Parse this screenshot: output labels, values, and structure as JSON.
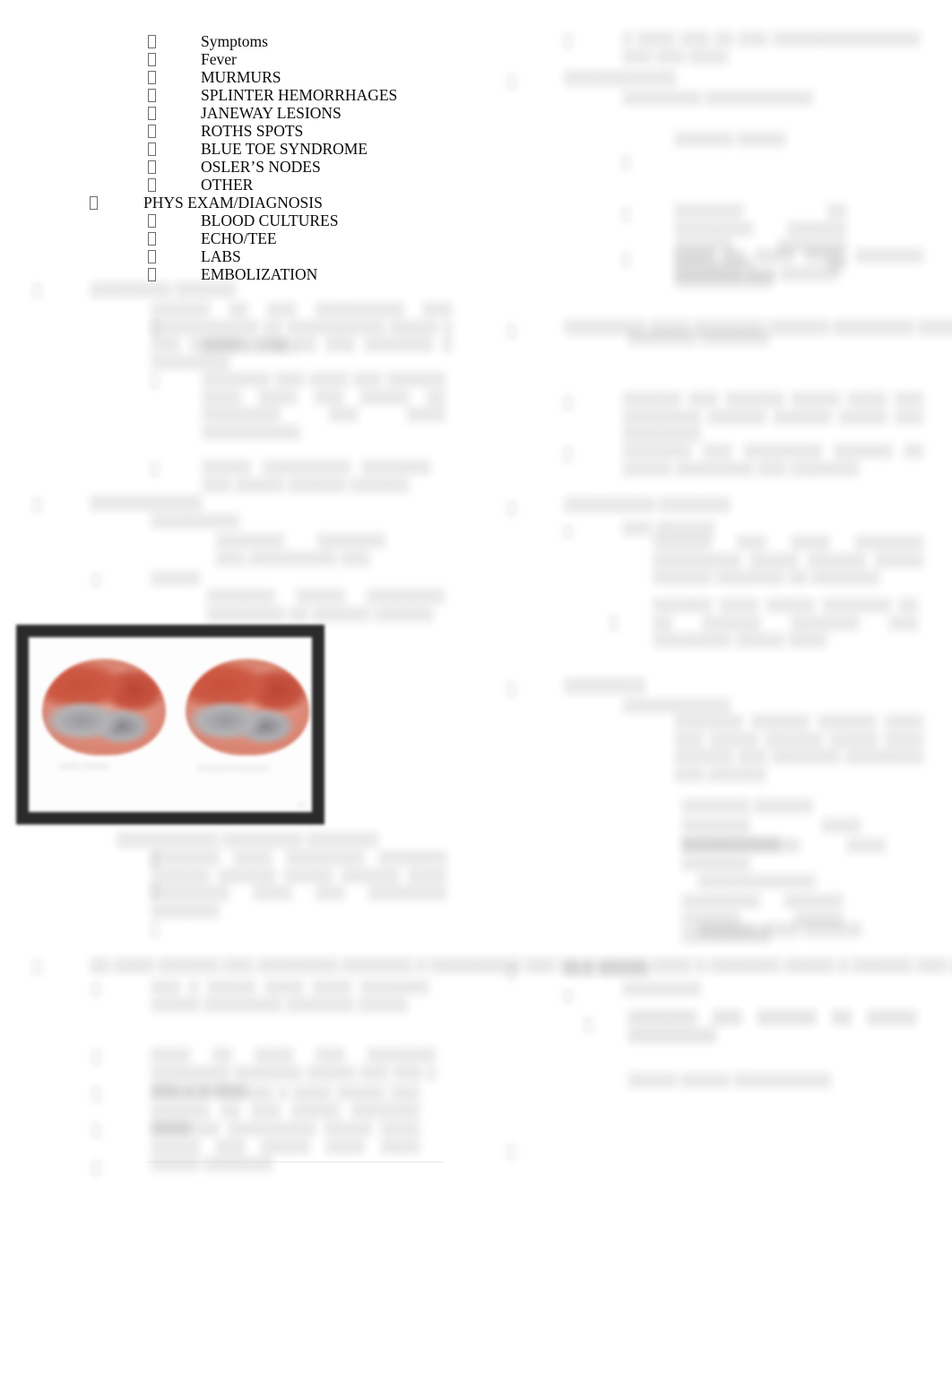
{
  "document": {
    "type": "outline-notes",
    "page_background": "#ffffff",
    "text_color": "#0b0b0b",
    "columns": 2
  },
  "left_column": {
    "legible_outline": {
      "items": [
        {
          "level": 2,
          "label": "Symptoms"
        },
        {
          "level": 2,
          "label": "Fever"
        },
        {
          "level": 2,
          "label": "MURMURS"
        },
        {
          "level": 2,
          "label": "SPLINTER HEMORRHAGES"
        },
        {
          "level": 2,
          "label": "JANEWAY LESIONS"
        },
        {
          "level": 2,
          "label": "ROTHS SPOTS"
        },
        {
          "level": 2,
          "label": "BLUE TOE SYNDROME"
        },
        {
          "level": 2,
          "label": "OSLER’S NODES"
        },
        {
          "level": 2,
          "label": "OTHER"
        },
        {
          "level": 1,
          "label": "PHYS EXAM/DIAGNOSIS"
        },
        {
          "level": 2,
          "label": "BLOOD CULTURES"
        },
        {
          "level": 2,
          "label": "ECHO/TEE"
        },
        {
          "level": 2,
          "label": "LABS"
        },
        {
          "level": 2,
          "label": "EMBOLIZATION"
        }
      ]
    },
    "obscured_blocks": [
      {
        "id": "lc-head-1",
        "text": "░░░░░░░░ ░░░░░░"
      },
      {
        "id": "lc-para-1",
        "text": "░░░░░░ ░░ ░░░ ░░░░░░░░░ ░░░ ░░░░░░░░░░░ ░░ ░░░░░░░░░░ ░░░░░ ░ ░░░ ░░░░░░ ░░░ ░░ ░░░ ░░░░░░░ ░ ░░░░░░░░"
      },
      {
        "id": "lc-para-2",
        "text": "░░░░ ░░ ░░░"
      },
      {
        "id": "lc-para-3",
        "text": "░░░░░░░ ░░░ ░░░░ ░░░ ░░░░░░ ░░░░ ░░░░ ░░░ ░░░░░ ░░ ░░░░░░░░ ░░░ ░░░░ ░░░░░░░░░░"
      },
      {
        "id": "lc-para-4",
        "text": "░░░░░ ░░░░░░░░░ ░░░░░░░ ░░░ ░░░░░ ░░░░░░ ░░░░░░"
      },
      {
        "id": "lc-head-2",
        "text": "░░░░░░░░░░░"
      },
      {
        "id": "lc-para-5",
        "text": "░░░░░░░░░"
      },
      {
        "id": "lc-para-6",
        "text": "░░░░░░░ ░░░░░░░ ░░░ ░░░░░░░░░ ░░░"
      },
      {
        "id": "lc-para-7",
        "text": "░░░░░"
      },
      {
        "id": "lc-para-8",
        "text": "░░░░░░░ ░░░░░ ░░░░░░░░ ░░░░░░░░ ░░ ░░░░░░ ░░░░░░"
      },
      {
        "id": "lc-head-3",
        "text": "░░░░░░░░░░ ░░░░░░░░ ░░░░░░░"
      },
      {
        "id": "lc-para-9",
        "text": "░░░░░░░ ░░░░ ░░░░░░░░ ░░░░░░░ ░░░░░░ ░░░░░░ ░░░░░ ░░░░░░ ░░░░ ░░░░░░░░ ░░░░ ░░░ ░░░░░░░░ ░░░░░░░"
      },
      {
        "id": "lc-head-4",
        "text": "░░░░░░░░░░"
      },
      {
        "id": "lc-para-10",
        "text": "░░ ░░░░ ░░░░░░ ░░░ ░░░░░░░░ ░░░░░░░ ░ ░░░░░░░░░ ░░░ ░░ ░ ░░░░░ ░░░░ ░ ░░░░░░░ ░░░░░ ░ ░░░░░░ ░░░ ░░ ░░░░░"
      },
      {
        "id": "lc-para-11",
        "text": "░░░ ░ ░░░░░ ░░░░ ░░░░ ░░░░░░░ ░░░░░ ░░░░░░░░ ░░░░░░░ ░░░░░"
      },
      {
        "id": "lc-para-12",
        "text": "░░░░ ░░ ░░░░ ░░░ ░░░░░░░ ░░░░░░░░ ░░░░░░░ ░░░░░ ░░░ ░░░ ░ ░░░ ░ ░░░░░"
      },
      {
        "id": "lc-para-13",
        "text": "░░░░░░ ░░░░░░ ░ ░░░░ ░░░░░ ░░░ ░░░░░░ ░░ ░░░ ░░░░░ ░░░░░░░ ░░░░"
      },
      {
        "id": "lc-para-14",
        "text": "░░░░░░░ ░░░░░░░░░ ░░░░░ ░░░░ ░░░░░ ░░░ ░░░░░ ░░░░ ░░░░ ░░░░░ ░░░░░░░"
      }
    ]
  },
  "right_column": {
    "obscured_blocks": [
      {
        "id": "rc-para-1",
        "text": "░ ░░░░ ░░░ ░░ ░░░ ░░░░░░░░░░░░░░░ ░░░ ░░░ ░░░░"
      },
      {
        "id": "rc-head-1",
        "text": "░░░░░░░░░░░"
      },
      {
        "id": "rc-para-2",
        "text": "░░░░░░░░ ░░░░░░░░░░░"
      },
      {
        "id": "rc-para-3",
        "text": "░░░░░░░ ░░░░░ ░░ ░░░░░░░ ░░░"
      },
      {
        "id": "rc-para-4",
        "text": "░░░░░░ ░░░░░"
      },
      {
        "id": "rc-para-5",
        "text": "░░░░░░░ ░░ ░░░░░░░░ ░░░░░░ ░░░░░░ ░░░░░░░ ░░░░░░░░ ░░ ░░░░░░░░░░"
      },
      {
        "id": "rc-para-6",
        "text": "░░░░ ░░ ░░░░ ░░░░ ░░░░░░░ ░░░░░░░ ░░░ ░░░░░░"
      },
      {
        "id": "rc-para-7",
        "text": "░░░░░░░░ ░░░░ ░░░░░░░ ░░░░░░ ░░░░░░░░ ░░░░░ ░░░░░░ ░░░░ ░░░░░░ ░░░░░░ ░░░░░░░"
      },
      {
        "id": "rc-head-2",
        "text": "░░░░░░░ ░░░░░░░"
      },
      {
        "id": "rc-para-8",
        "text": "░░░░░░ ░░░ ░░░░░░ ░░░░░ ░░░░ ░░░ ░░░░░░░░ ░░░░░░ ░░░░░░ ░░░░░ ░░░ ░░░░░░░░"
      },
      {
        "id": "rc-para-9",
        "text": "░░░░░░░ ░░░ ░░░░░░░░ ░░░░░░ ░░ ░░░░░ ░░░░░░░░ ░░░ ░░░░░░░"
      },
      {
        "id": "rc-para-10",
        "text": "░░░░░░ ░░ ░░░ ░░░░░░░░ ░░░░ ░░░░ ░░░░ ░░░░░░ ░░░░ ░░░░░░░ ░░░░░░"
      },
      {
        "id": "rc-head-3",
        "text": "░░░░░░░░░ ░░░░░░░"
      },
      {
        "id": "rc-para-11",
        "text": "░░░ ░░░░░░"
      },
      {
        "id": "rc-para-12",
        "text": "░░░░░░ ░░░ ░░░░ ░░░░░░░ ░░░░░░░░░ ░░░░░ ░░░░░░ ░░░░░ ░░░░░░ ░░░░░░░ ░░ ░░░░░░░"
      },
      {
        "id": "rc-para-13",
        "text": "░░░░"
      },
      {
        "id": "rc-para-14",
        "text": "░░░░░░ ░░░░ ░░░░░ ░░░░░░░ ░░ ░░ ░░░░░░ ░░░░░░░ ░░░ ░░░░░░░░ ░░░░░ ░░░░"
      },
      {
        "id": "rc-head-4",
        "text": "░░░░░░░░"
      },
      {
        "id": "rc-para-15",
        "text": "░░░░░░░░░░░"
      },
      {
        "id": "rc-para-16",
        "text": "░░░░░░░ ░░░░░░ ░░░░░░ ░░░░ ░░░ ░░░░░ ░░░░░░ ░░░░░ ░░░░ ░░░░░░ ░░░ ░░░░░░░ ░░░░░░░░ ░░░ ░░░░░░"
      },
      {
        "id": "rc-para-17",
        "text": "░░░░░░░ ░░░░░░"
      },
      {
        "id": "rc-para-18",
        "text": "░░░░░░░ ░░░░ ░░░░░░░░░░"
      },
      {
        "id": "rc-para-19",
        "text": "░░░░░░░░░░░░ ░░░░ ░░░░░░░"
      },
      {
        "id": "rc-para-20",
        "text": "░░░░░░░░░░░░"
      },
      {
        "id": "rc-para-21",
        "text": "░░░░░░░░ ░░░░░░ ░░░░░░ ░░░░░ ░░░░░░░░░"
      },
      {
        "id": "rc-head-5",
        "text": "░░░░░░ ░░░░ ░░░░░░"
      },
      {
        "id": "rc-para-22",
        "text": "░░░ ░░░░░"
      },
      {
        "id": "rc-para-23",
        "text": "░░░░░░░░"
      },
      {
        "id": "rc-para-24",
        "text": "░░░░░ ░░░░░░ ░░░░░ ░░░░░░ ░░ ░░░░░░░ ░░ ░░░░░░░ ░░░░ ░░░░░░░ ░░░ ░░░░░"
      },
      {
        "id": "rc-para-25",
        "text": "░░░░░░░ ░░░ ░░░░░░ ░░ ░░░░░ ░░░░░░░░░"
      },
      {
        "id": "rc-head-6",
        "text": "░░░░░ ░░░░░ ░░░░░░░░░░"
      }
    ]
  },
  "figure": {
    "name": "anatomical-cross-section-pair",
    "border_color": "#2b2b2b",
    "accent_color": "#c8503c",
    "tissue_color": "#dd8d7c",
    "caption_left": "░░░░░\n░░░░░░",
    "caption_right": "░░░░░░░\n░░░░░░░░░",
    "credit": "░░░"
  }
}
